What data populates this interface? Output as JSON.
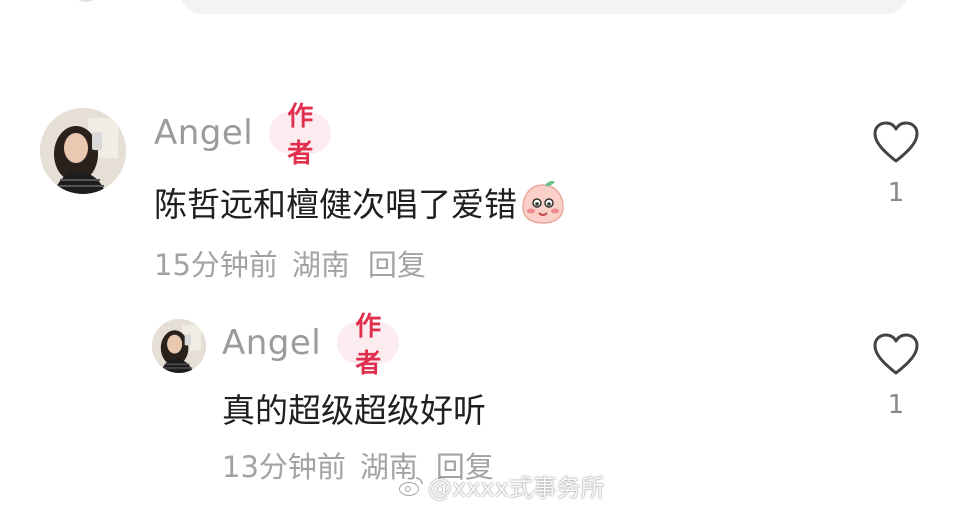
{
  "comments": [
    {
      "username": "Angel",
      "badge": "作者",
      "text": "陈哲远和檀健次唱了爱错",
      "emoji": "blush-peach-emoji",
      "time": "15分钟前",
      "location": "湖南",
      "reply_label": "回复",
      "likes": "1"
    },
    {
      "username": "Angel",
      "badge": "作者",
      "text": "真的超级超级好听",
      "time": "13分钟前",
      "location": "湖南",
      "reply_label": "回复",
      "likes": "1"
    }
  ],
  "watermark": "@xxxx式事务所",
  "icons": {
    "like": "heart-outline-icon",
    "watermark": "weibo-logo-icon"
  },
  "colors": {
    "badge_bg": "#fdecef",
    "badge_text": "#e0304e",
    "username": "#9b9b9b",
    "meta": "#a3a3a3"
  }
}
